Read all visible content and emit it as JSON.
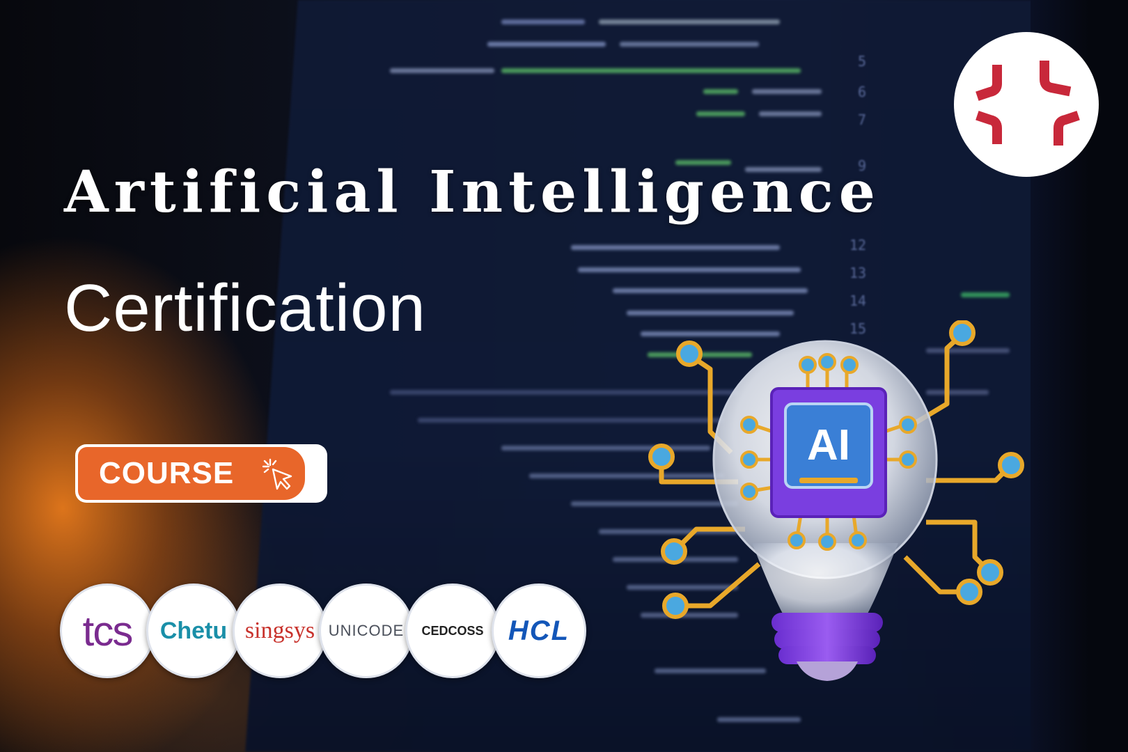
{
  "banner": {
    "title": "Artificial Intelligence",
    "subtitle": "Certification",
    "cta_label": "COURSE",
    "cta_icon": "cursor-click-icon"
  },
  "brand": {
    "icon": "brand-mark-icon",
    "color": "#c8283a"
  },
  "partners": [
    {
      "name": "tcs"
    },
    {
      "name": "Chetu"
    },
    {
      "name": "singsys"
    },
    {
      "name": "UNICODE"
    },
    {
      "name": "CEDCOSS"
    },
    {
      "name": "HCL"
    }
  ],
  "illustration": {
    "icon": "ai-lightbulb-icon",
    "chip_label": "AI"
  },
  "colors": {
    "accent": "#e8662a",
    "chip": "#7a3ee0",
    "chip_face": "#3a7fd6",
    "circuit": "#e8a82a",
    "node": "#4aa8e0"
  }
}
